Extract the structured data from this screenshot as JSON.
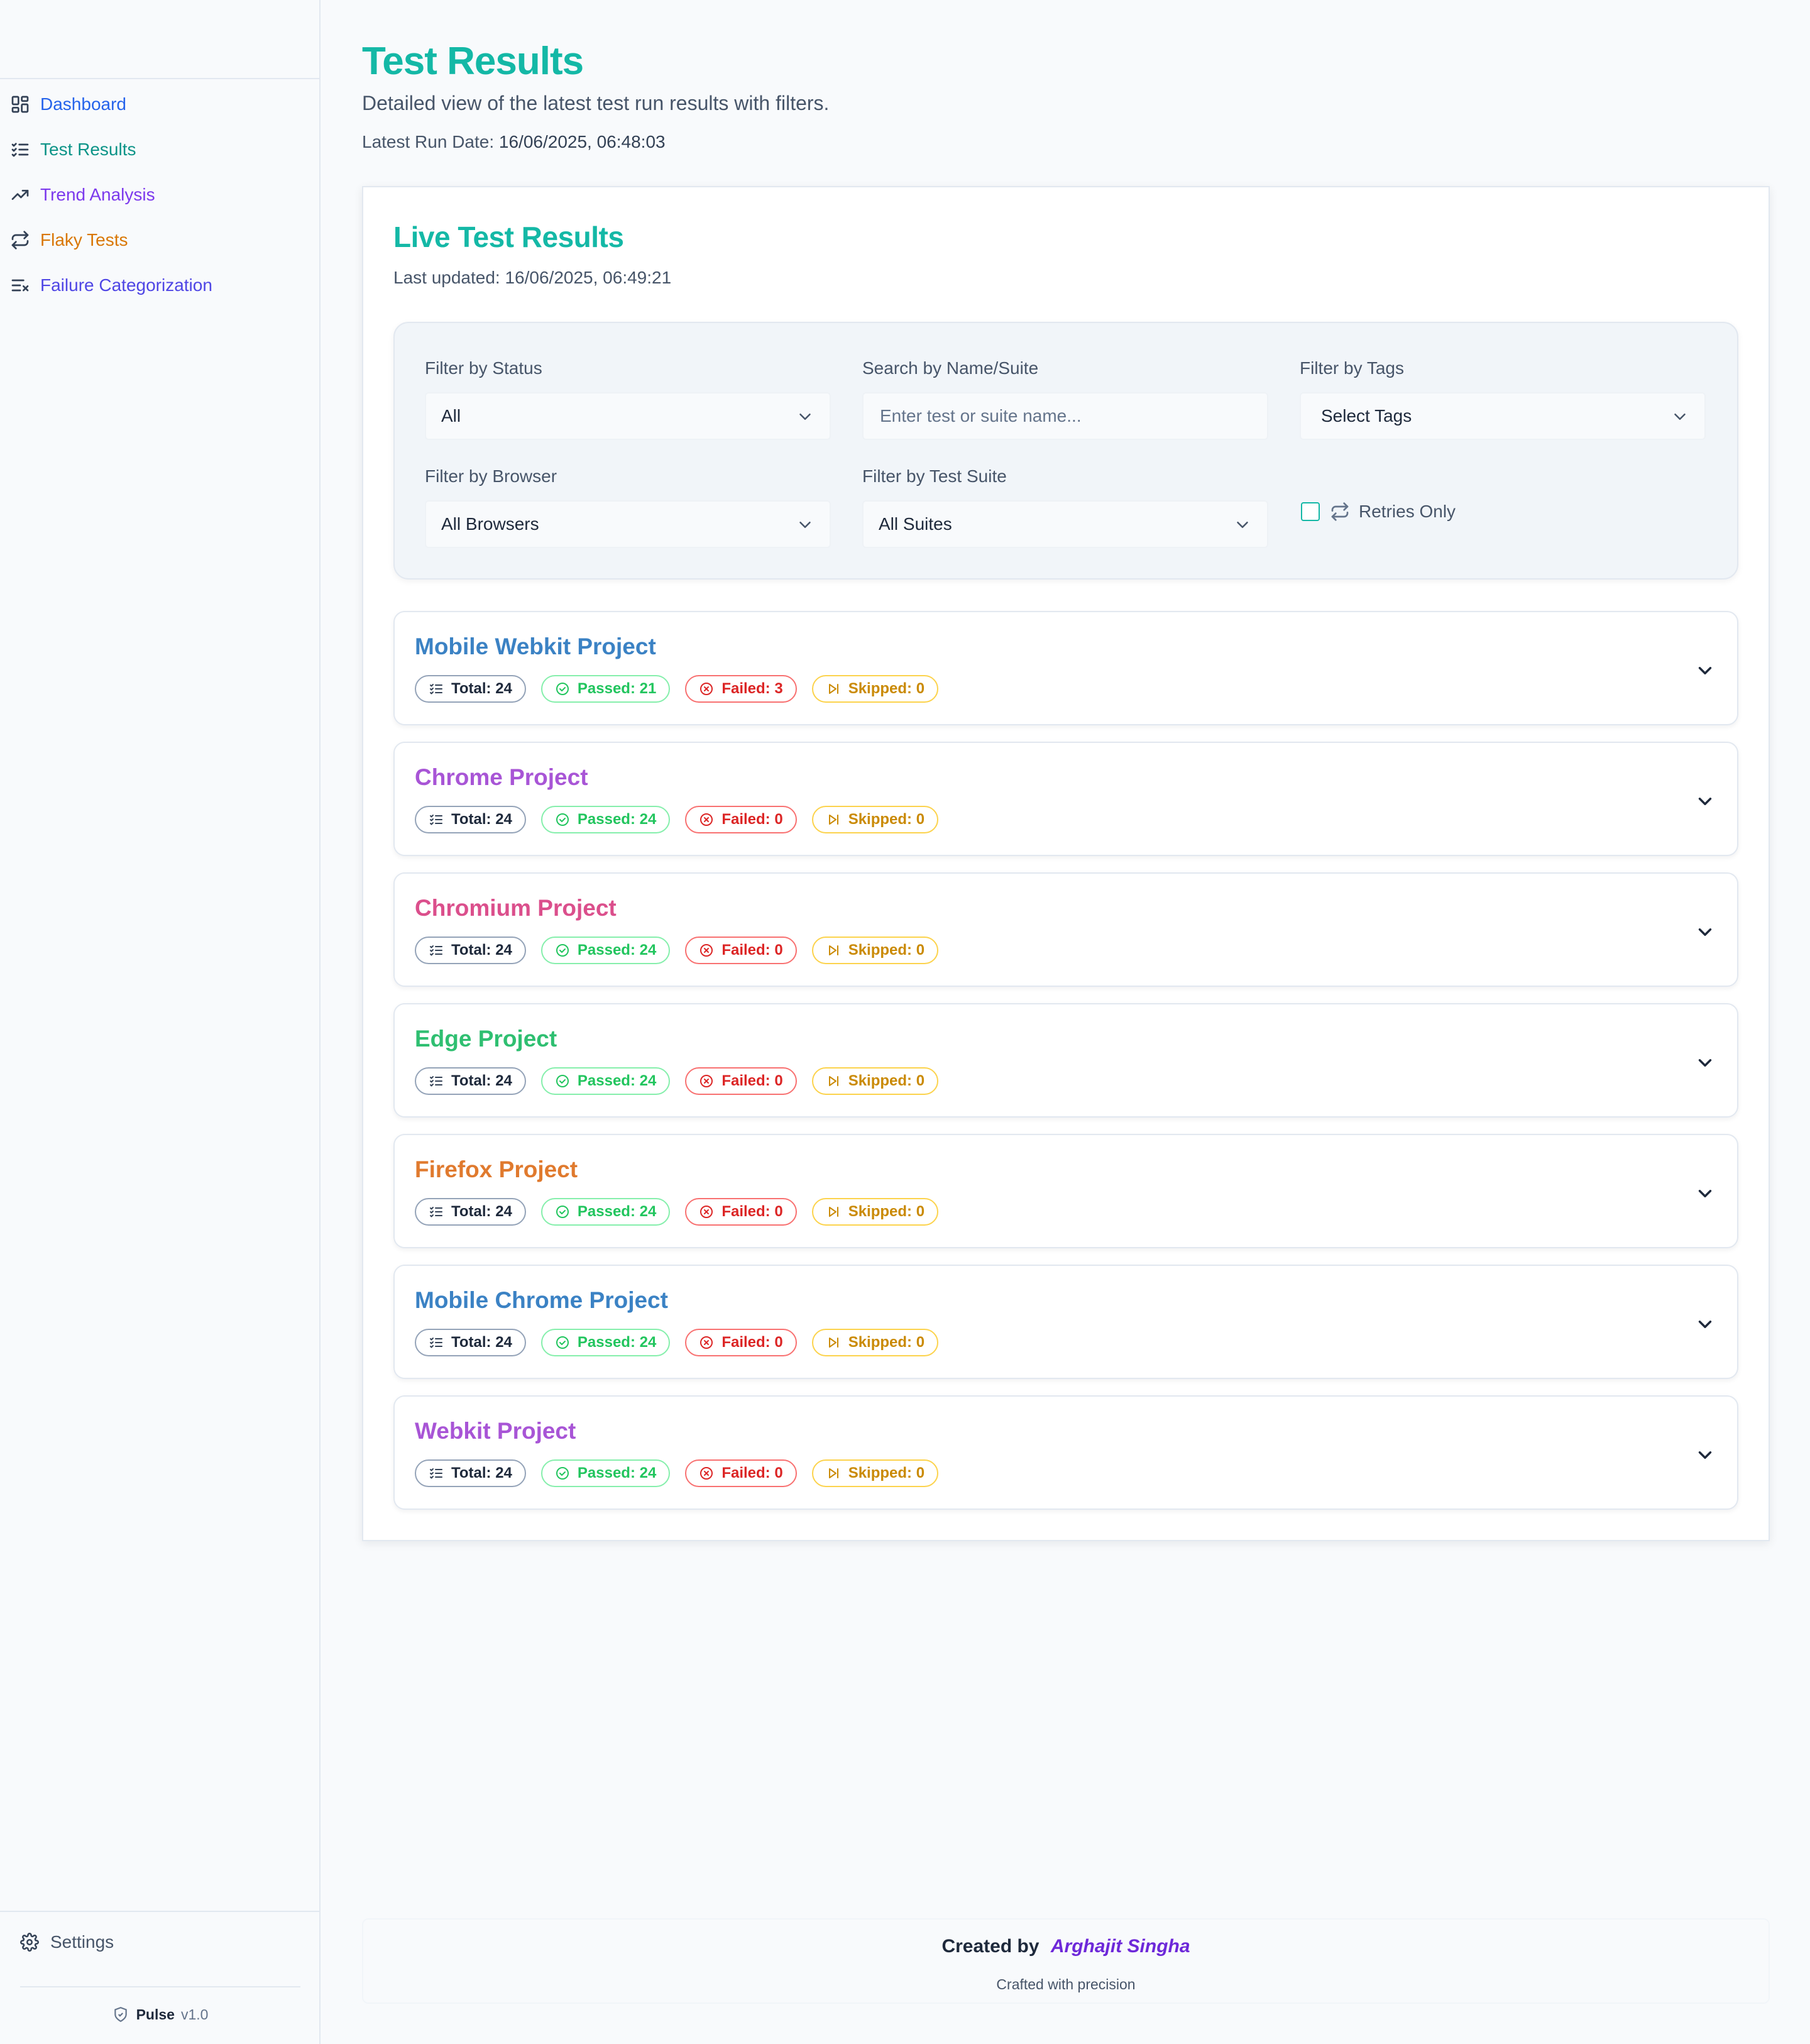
{
  "sidebar": {
    "nav": [
      {
        "label": "Dashboard",
        "icon": "dashboard-grid-icon",
        "color": "#2563eb"
      },
      {
        "label": "Test Results",
        "icon": "list-checks-icon",
        "color": "#0d9488",
        "active": true
      },
      {
        "label": "Trend Analysis",
        "icon": "trending-up-icon",
        "color": "#7c3aed"
      },
      {
        "label": "Flaky Tests",
        "icon": "repeat-icon",
        "color": "#d97706"
      },
      {
        "label": "Failure Categorization",
        "icon": "list-x-icon",
        "color": "#4f46e5"
      }
    ],
    "settings_label": "Settings",
    "brand": "Pulse",
    "version": "v1.0"
  },
  "page": {
    "title": "Test Results",
    "subtitle": "Detailed view of the latest test run results with filters.",
    "run_date_label": "Latest Run Date:",
    "run_date_value": "16/06/2025, 06:48:03"
  },
  "card": {
    "title": "Live Test Results",
    "last_updated": "Last updated: 16/06/2025, 06:49:21"
  },
  "filters": {
    "status": {
      "label": "Filter by Status",
      "value": "All"
    },
    "search": {
      "label": "Search by Name/Suite",
      "placeholder": "Enter test or suite name...",
      "value": ""
    },
    "tags": {
      "label": "Filter by Tags",
      "value": "Select Tags"
    },
    "browser": {
      "label": "Filter by Browser",
      "value": "All Browsers"
    },
    "suite": {
      "label": "Filter by Test Suite",
      "value": "All Suites"
    },
    "retries": {
      "label": "Retries Only",
      "checked": false
    }
  },
  "projects": [
    {
      "name": "Mobile Webkit Project",
      "color": "#3b82c4",
      "total": "Total: 24",
      "passed": "Passed: 21",
      "failed": "Failed: 3",
      "skipped": "Skipped: 0"
    },
    {
      "name": "Chrome Project",
      "color": "#a855d6",
      "total": "Total: 24",
      "passed": "Passed: 24",
      "failed": "Failed: 0",
      "skipped": "Skipped: 0"
    },
    {
      "name": "Chromium Project",
      "color": "#db4f8c",
      "total": "Total: 24",
      "passed": "Passed: 24",
      "failed": "Failed: 0",
      "skipped": "Skipped: 0"
    },
    {
      "name": "Edge Project",
      "color": "#2fbf71",
      "total": "Total: 24",
      "passed": "Passed: 24",
      "failed": "Failed: 0",
      "skipped": "Skipped: 0"
    },
    {
      "name": "Firefox Project",
      "color": "#e07a2e",
      "total": "Total: 24",
      "passed": "Passed: 24",
      "failed": "Failed: 0",
      "skipped": "Skipped: 0"
    },
    {
      "name": "Mobile Chrome Project",
      "color": "#3b82c4",
      "total": "Total: 24",
      "passed": "Passed: 24",
      "failed": "Failed: 0",
      "skipped": "Skipped: 0"
    },
    {
      "name": "Webkit Project",
      "color": "#a855d6",
      "total": "Total: 24",
      "passed": "Passed: 24",
      "failed": "Failed: 0",
      "skipped": "Skipped: 0"
    }
  ],
  "footer": {
    "created_by": "Created by",
    "author": "Arghajit Singha",
    "tagline": "Crafted with precision"
  }
}
